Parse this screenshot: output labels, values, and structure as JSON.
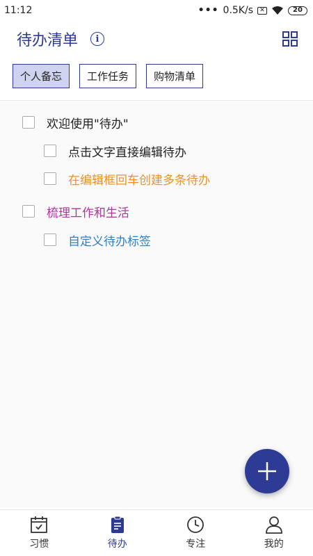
{
  "status_bar": {
    "time": "11:12",
    "dots": "•••",
    "speed": "0.5K/s",
    "sim_icon": "sim-error-icon",
    "sim_glyph": "✕",
    "wifi_icon": "wifi-icon",
    "battery": "20"
  },
  "header": {
    "title": "待办清单",
    "info_icon": "info-icon",
    "info_glyph": "i",
    "layout_icon": "grid-icon"
  },
  "tabs": [
    {
      "label": "个人备忘",
      "active": true
    },
    {
      "label": "工作任务",
      "active": false
    },
    {
      "label": "购物清单",
      "active": false
    }
  ],
  "todos": [
    {
      "text": "欢迎使用\"待办\"",
      "level": 0,
      "color": "#222222"
    },
    {
      "text": "点击文字直接编辑待办",
      "level": 1,
      "color": "#222222"
    },
    {
      "text": "在编辑框回车创建多条待办",
      "level": 1,
      "color": "#e8922a"
    },
    {
      "text": "梳理工作和生活",
      "level": 0,
      "color": "#b2349b"
    },
    {
      "text": "自定义待办标签",
      "level": 1,
      "color": "#2b7fc9"
    }
  ],
  "fab": {
    "icon": "plus-icon"
  },
  "bottom_nav": [
    {
      "label": "习惯",
      "icon": "calendar-check-icon",
      "active": false
    },
    {
      "label": "待办",
      "icon": "clipboard-icon",
      "active": true
    },
    {
      "label": "专注",
      "icon": "clock-icon",
      "active": false
    },
    {
      "label": "我的",
      "icon": "user-icon",
      "active": false
    }
  ],
  "colors": {
    "primary": "#2c3b8f",
    "tab_active_bg": "#cfd3ef",
    "fab": "#2e3b95"
  }
}
